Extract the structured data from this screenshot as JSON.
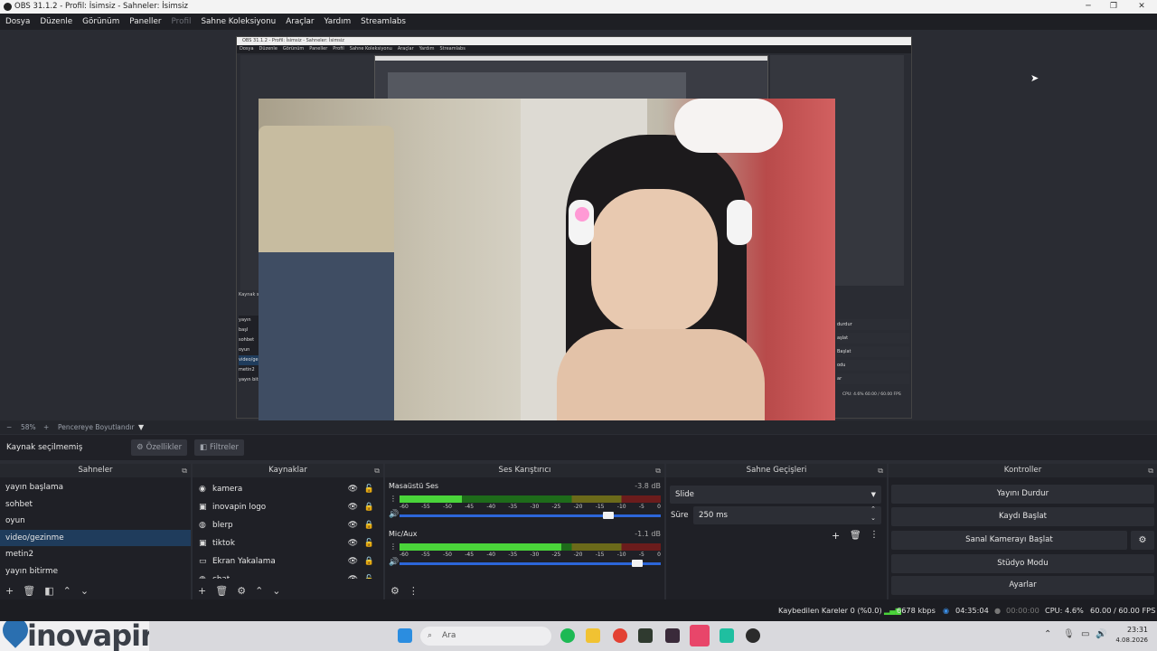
{
  "window": {
    "title": "OBS 31.1.2 - Profil: İsimsiz - Sahneler: İsimsiz"
  },
  "menu": {
    "items": [
      {
        "label": "Dosya",
        "disabled": false
      },
      {
        "label": "Düzenle",
        "disabled": false
      },
      {
        "label": "Görünüm",
        "disabled": false
      },
      {
        "label": "Paneller",
        "disabled": false
      },
      {
        "label": "Profil",
        "disabled": true
      },
      {
        "label": "Sahne Koleksiyonu",
        "disabled": false
      },
      {
        "label": "Araçlar",
        "disabled": false
      },
      {
        "label": "Yardım",
        "disabled": false
      },
      {
        "label": "Streamlabs",
        "disabled": false
      }
    ]
  },
  "preview": {
    "nested_title": "OBS 31.1.2 - Profil: İsimsiz - Sahneler: İsimsiz",
    "nested_menu": [
      "Dosya",
      "Düzenle",
      "Görünüm",
      "Paneller",
      "Profil",
      "Sahne Koleksiyonu",
      "Araçlar",
      "Yardım",
      "Streamlabs"
    ],
    "nested_scenes": [
      "yayın başl",
      "sohbet",
      "oyun",
      "video/ge",
      "metin2",
      "yayın biti"
    ],
    "nested_source_label": "Kaynak s",
    "nested_controls": [
      "durdur",
      "aşlat",
      "Başlat",
      "odu",
      "ar"
    ],
    "nested_status": "CPU: 4.6%   60.00 / 60.00 FPS"
  },
  "zoom": {
    "minus": "−",
    "value": "58%",
    "plus": "+",
    "fit": "Pencereye Boyutlandır"
  },
  "infobar": {
    "status": "Kaynak seçilmemiş",
    "properties": "Özellikler",
    "filters": "Filtreler"
  },
  "scenes": {
    "title": "Sahneler",
    "items": [
      "yayın başlama",
      "sohbet",
      "oyun",
      "video/gezinme",
      "metin2",
      "yayın bitirme"
    ],
    "selected_index": 3
  },
  "sources": {
    "title": "Kaynaklar",
    "items": [
      {
        "name": "kamera",
        "icon": "camera-icon",
        "glyph": "◉",
        "locked": false
      },
      {
        "name": "inovapin logo",
        "icon": "image-icon",
        "glyph": "▣",
        "locked": true
      },
      {
        "name": "blerp",
        "icon": "browser-icon",
        "glyph": "◍",
        "locked": true
      },
      {
        "name": "tiktok",
        "icon": "image-icon",
        "glyph": "▣",
        "locked": false
      },
      {
        "name": "Ekran Yakalama",
        "icon": "monitor-icon",
        "glyph": "▭",
        "locked": true
      },
      {
        "name": "chat",
        "icon": "browser-icon",
        "glyph": "◍",
        "locked": false
      }
    ]
  },
  "mixer": {
    "title": "Ses Karıştırıcı",
    "channels": [
      {
        "name": "Masaüstü Ses",
        "db": "-3.8 dB",
        "level": 0.24,
        "volume": 0.8
      },
      {
        "name": "Mic/Aux",
        "db": "-1.1 dB",
        "level": 0.62,
        "volume": 0.91
      }
    ],
    "ticks": [
      "-60",
      "-55",
      "-50",
      "-45",
      "-40",
      "-35",
      "-30",
      "-25",
      "-20",
      "-15",
      "-10",
      "-5",
      "0"
    ]
  },
  "transitions": {
    "title": "Sahne Geçişleri",
    "selected": "Slide",
    "duration_label": "Süre",
    "duration": "250 ms"
  },
  "controls": {
    "title": "Kontroller",
    "stop_stream": "Yayını Durdur",
    "start_record": "Kaydı Başlat",
    "virtual_cam": "Sanal Kamerayı Başlat",
    "studio_mode": "Stüdyo Modu",
    "settings": "Ayarlar"
  },
  "status": {
    "dropped": "Kaybedilen Kareler 0 (%0.0)",
    "bitrate": "6678 kbps",
    "stream_time": "04:35:04",
    "record_time": "00:00:00",
    "cpu": "CPU: 4.6%",
    "fps": "60.00 / 60.00 FPS"
  },
  "overlay": {
    "logo_text": "inovapin"
  },
  "taskbar": {
    "search": "Ara",
    "time": "23:31",
    "date": "4.08.2026"
  },
  "colors": {
    "accent": "#1f3c5c",
    "meter_green": "#4ad43a",
    "slider_blue": "#2c66d9"
  }
}
